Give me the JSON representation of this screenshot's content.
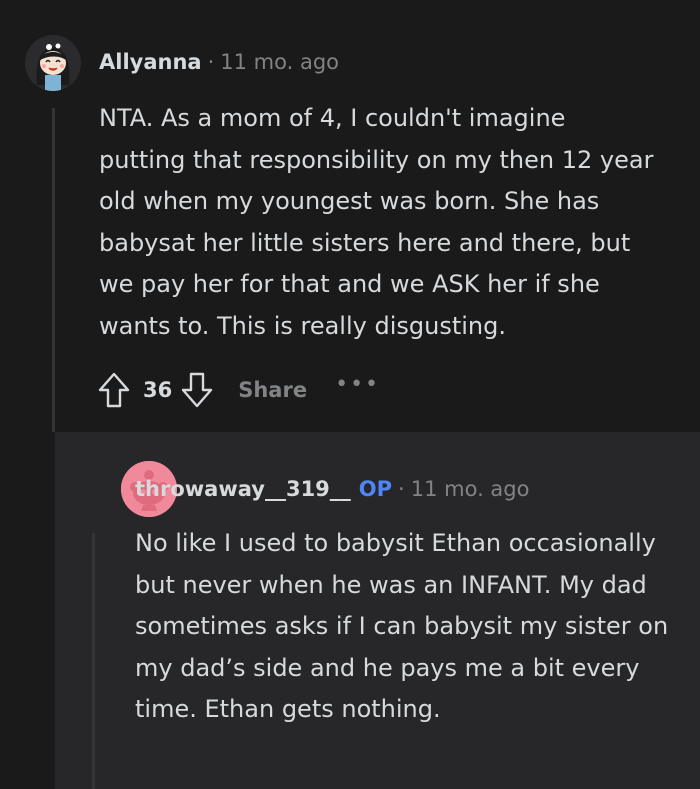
{
  "comment": {
    "username": "Allyanna",
    "separator": "·",
    "time": "11 mo. ago",
    "body": "NTA. As a mom of 4, I couldn't imagine putting that responsibility on my then 12 year old when my youngest was born. She has babysat her little sisters here and there, but we pay her for that and we ASK her if she wants to. This is really disgusting.",
    "score": "36",
    "share_label": "Share",
    "more_label": "•••"
  },
  "reply": {
    "username": "throwaway__319__",
    "op_badge": "OP",
    "separator": "·",
    "time": "11 mo. ago",
    "body": "No like I used to babysit Ethan occasionally but never when he was an INFANT. My dad sometimes asks if I can babysit my sister on my dad’s side and he pays me a bit every time. Ethan gets nothing."
  },
  "colors": {
    "background": "#1a1a1b",
    "reply_background": "#272729",
    "text": "#d7dadc",
    "muted": "#818384",
    "op_badge": "#4f86f7",
    "default_avatar": "#f08a9a"
  }
}
